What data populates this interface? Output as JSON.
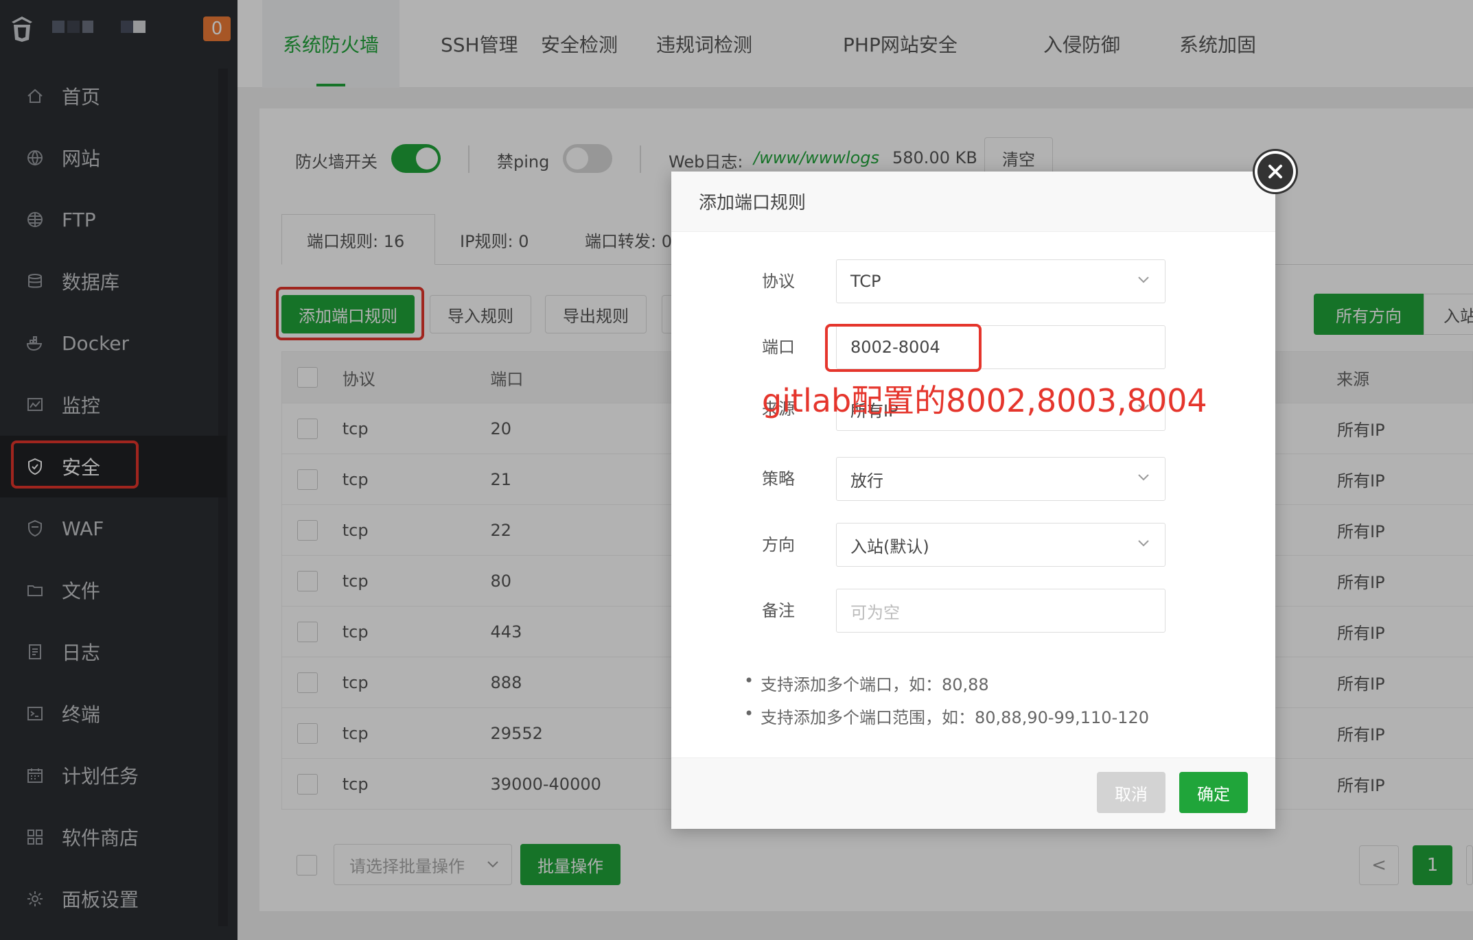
{
  "sidebar": {
    "badge": "0",
    "items": [
      {
        "label": "首页",
        "icon": "home-icon"
      },
      {
        "label": "网站",
        "icon": "globe-icon"
      },
      {
        "label": "FTP",
        "icon": "ftp-globe-icon"
      },
      {
        "label": "数据库",
        "icon": "database-icon"
      },
      {
        "label": "Docker",
        "icon": "docker-icon"
      },
      {
        "label": "监控",
        "icon": "monitor-icon"
      },
      {
        "label": "安全",
        "icon": "shield-icon",
        "active": true
      },
      {
        "label": "WAF",
        "icon": "waf-shield-icon"
      },
      {
        "label": "文件",
        "icon": "folder-icon"
      },
      {
        "label": "日志",
        "icon": "log-icon"
      },
      {
        "label": "终端",
        "icon": "terminal-icon"
      },
      {
        "label": "计划任务",
        "icon": "calendar-icon"
      },
      {
        "label": "软件商店",
        "icon": "apps-icon"
      },
      {
        "label": "面板设置",
        "icon": "gear-icon"
      }
    ]
  },
  "tabs": [
    "系统防火墙",
    "SSH管理",
    "安全检测",
    "违规词检测",
    "PHP网站安全",
    "入侵防御",
    "系统加固"
  ],
  "controls": {
    "firewall_switch_label": "防火墙开关",
    "ping_label": "禁ping",
    "weblog_label": "Web日志:",
    "weblog_path": "/www/wwwlogs",
    "weblog_size": "580.00 KB",
    "clear_button": "清空"
  },
  "subtabs": [
    "端口规则: 16",
    "IP规则: 0",
    "端口转发: 0"
  ],
  "toolbar": {
    "add_rule": "添加端口规则",
    "import_rules": "导入规则",
    "export_rules": "导出规则",
    "all_directions": "所有方向",
    "inbound": "入站"
  },
  "table": {
    "headers": {
      "protocol": "协议",
      "port": "端口",
      "source": "来源"
    },
    "rows": [
      {
        "protocol": "tcp",
        "port": "20",
        "source": "所有IP"
      },
      {
        "protocol": "tcp",
        "port": "21",
        "source": "所有IP"
      },
      {
        "protocol": "tcp",
        "port": "22",
        "source": "所有IP"
      },
      {
        "protocol": "tcp",
        "port": "80",
        "source": "所有IP"
      },
      {
        "protocol": "tcp",
        "port": "443",
        "source": "所有IP"
      },
      {
        "protocol": "tcp",
        "port": "888",
        "source": "所有IP"
      },
      {
        "protocol": "tcp",
        "port": "29552",
        "source": "所有IP"
      },
      {
        "protocol": "tcp",
        "port": "39000-40000",
        "source": "所有IP"
      }
    ]
  },
  "footer": {
    "batch_select_placeholder": "请选择批量操作",
    "batch_button": "批量操作",
    "current_page": "1",
    "prev": "<"
  },
  "modal": {
    "title": "添加端口规则",
    "protocol_label": "协议",
    "protocol_value": "TCP",
    "port_label": "端口",
    "port_value": "8002-8004",
    "source_label": "来源",
    "source_value": "所有IP",
    "strategy_label": "策略",
    "strategy_value": "放行",
    "direction_label": "方向",
    "direction_value": "入站(默认)",
    "remark_label": "备注",
    "remark_placeholder": "可为空",
    "hints": [
      "支持添加多个端口，如：80,88",
      "支持添加多个端口范围，如：80,88,90-99,110-120"
    ],
    "cancel": "取消",
    "confirm": "确定"
  },
  "annotation": "gitlab配置的8002,8003,8004",
  "colors": {
    "accent": "#20a53a",
    "highlight": "#e5352c",
    "sidebar": "#2c2f33",
    "badge": "#ef7c37"
  }
}
